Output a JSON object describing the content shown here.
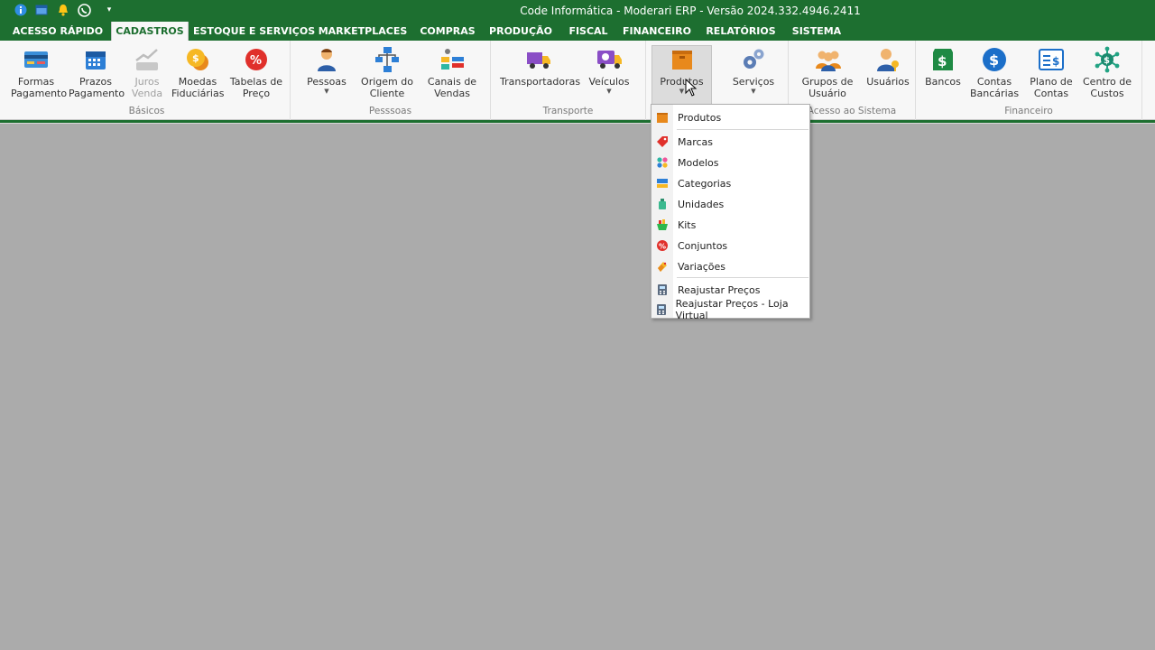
{
  "titlebar": {
    "title": "Code Informática - Moderari ERP - Versão 2024.332.4946.2411",
    "bg_color": "#1d6f30",
    "quick_access_icons": [
      "info-icon",
      "window-icon",
      "bell-icon",
      "whatsapp-icon",
      "customize-toolbar-icon"
    ]
  },
  "tabs": [
    {
      "label": "ACESSO RÁPIDO",
      "active": false
    },
    {
      "label": "CADASTROS",
      "active": true
    },
    {
      "label": "ESTOQUE E SERVIÇOS",
      "active": false
    },
    {
      "label": "MARKETPLACES",
      "active": false
    },
    {
      "label": "COMPRAS",
      "active": false
    },
    {
      "label": "PRODUÇÃO",
      "active": false
    },
    {
      "label": "FISCAL",
      "active": false
    },
    {
      "label": "FINANCEIRO",
      "active": false
    },
    {
      "label": "RELATÓRIOS",
      "active": false
    },
    {
      "label": "SISTEMA",
      "active": false
    }
  ],
  "ribbon": {
    "groups": [
      {
        "label": "Básicos",
        "buttons": [
          {
            "line1": "Formas",
            "line2": "Pagamento",
            "icon": "credit-card-icon"
          },
          {
            "line1": "Prazos",
            "line2": "Pagamento",
            "icon": "calendar-icon"
          },
          {
            "line1": "Juros",
            "line2": "Venda",
            "icon": "interest-chart-icon",
            "disabled": true
          },
          {
            "line1": "Moedas",
            "line2": "Fiduciárias",
            "icon": "coins-icon"
          },
          {
            "line1": "Tabelas de",
            "line2": "Preço",
            "icon": "percent-tag-icon"
          }
        ]
      },
      {
        "label": "Pesssoas",
        "buttons": [
          {
            "line1": "Pessoas",
            "line2": "",
            "icon": "person-icon",
            "dropdown": true
          },
          {
            "line1": "Origem do",
            "line2": "Cliente",
            "icon": "hierarchy-icon"
          },
          {
            "line1": "Canais de",
            "line2": "Vendas",
            "icon": "sales-channels-icon"
          }
        ]
      },
      {
        "label": "Transporte",
        "buttons": [
          {
            "line1": "Transportadoras",
            "line2": "",
            "icon": "truck-icon"
          },
          {
            "line1": "Veículos",
            "line2": "",
            "icon": "vehicle-icon",
            "dropdown": true
          }
        ]
      },
      {
        "label": "",
        "buttons": [
          {
            "line1": "Produtos",
            "line2": "",
            "icon": "box-icon",
            "dropdown": true,
            "hot": true
          },
          {
            "line1": "Serviços",
            "line2": "",
            "icon": "gears-icon",
            "dropdown": true
          }
        ]
      },
      {
        "label": "Acesso ao Sistema",
        "buttons": [
          {
            "line1": "Grupos de",
            "line2": "Usuário",
            "icon": "user-group-icon"
          },
          {
            "line1": "Usuários",
            "line2": "",
            "icon": "user-key-icon"
          }
        ]
      },
      {
        "label": "Financeiro",
        "buttons": [
          {
            "line1": "Bancos",
            "line2": "",
            "icon": "bank-icon"
          },
          {
            "line1": "Contas",
            "line2": "Bancárias",
            "icon": "dollar-circle-icon"
          },
          {
            "line1": "Plano de",
            "line2": "Contas",
            "icon": "accounts-plan-icon"
          },
          {
            "line1": "Centro de",
            "line2": "Custos",
            "icon": "cost-center-icon"
          }
        ]
      }
    ]
  },
  "dropdown": {
    "items": [
      {
        "label": "Produtos",
        "icon": "box-icon"
      },
      {
        "label": "Marcas",
        "icon": "tag-icon"
      },
      {
        "label": "Modelos",
        "icon": "models-icon"
      },
      {
        "label": "Categorias",
        "icon": "categories-icon"
      },
      {
        "label": "Unidades",
        "icon": "bottle-icon"
      },
      {
        "label": "Kits",
        "icon": "basket-icon"
      },
      {
        "label": "Conjuntos",
        "icon": "percent-badge-icon"
      },
      {
        "label": "Variações",
        "icon": "palette-icon"
      },
      {
        "label": "Reajustar Preços",
        "icon": "calculator-icon"
      },
      {
        "label": "Reajustar Preços - Loja Virtual",
        "icon": "calculator-icon"
      }
    ]
  },
  "colors": {
    "accent": "#1d6f30",
    "workspace": "#ababab",
    "ribbon": "#f7f7f7"
  }
}
